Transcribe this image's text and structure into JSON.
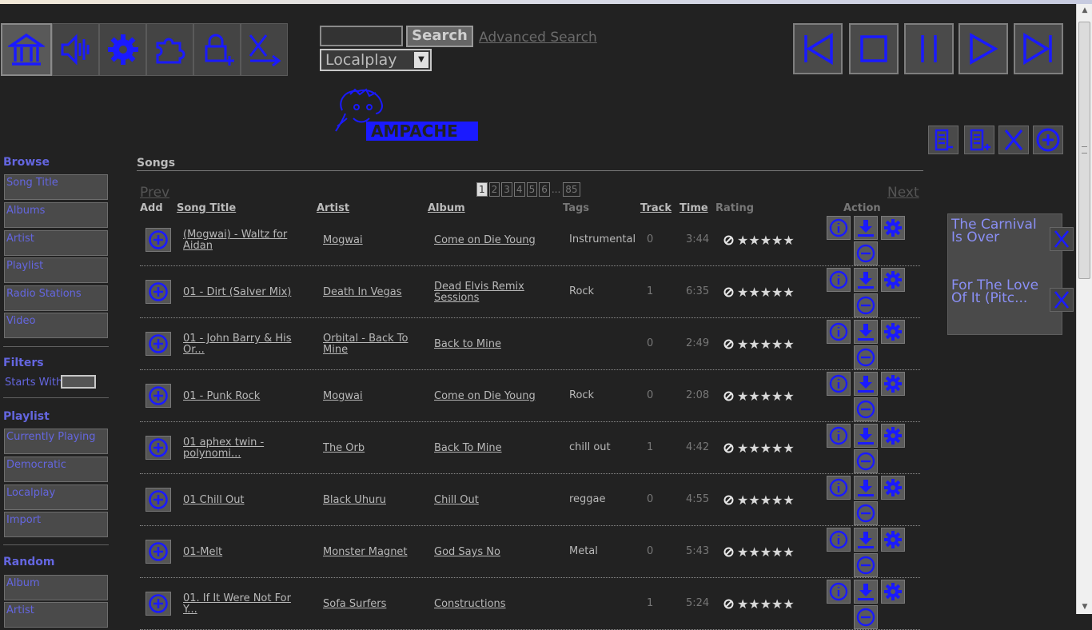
{
  "search": {
    "button_label": "Search",
    "advanced_label": "Advanced Search",
    "input_value": "",
    "player_select": "Localplay"
  },
  "nav_icons": [
    "home-icon",
    "speaker-icon",
    "gear-icon",
    "puzzle-icon",
    "lock-add-icon",
    "logout-icon"
  ],
  "sidebar": {
    "browse_heading": "Browse",
    "browse_items": [
      "Song Title",
      "Albums",
      "Artist",
      "Playlist",
      "Radio Stations",
      "Video"
    ],
    "filters_heading": "Filters",
    "starts_with_label": "Starts With",
    "playlist_heading": "Playlist",
    "playlist_items": [
      "Currently Playing",
      "Democratic",
      "Localplay",
      "Import"
    ],
    "random_heading": "Random",
    "random_items": [
      "Album",
      "Artist"
    ]
  },
  "songs": {
    "title": "Songs",
    "prev_label": "Prev",
    "next_label": "Next",
    "pages": [
      "1",
      "2",
      "3",
      "4",
      "5",
      "6"
    ],
    "pages_ellipsis": "...",
    "last_page": "85",
    "columns": {
      "add": "Add",
      "song_title": "Song Title",
      "artist": "Artist",
      "album": "Album",
      "tags": "Tags",
      "track": "Track",
      "time": "Time",
      "rating": "Rating",
      "action": "Action"
    },
    "rows": [
      {
        "title": "(Mogwai) - Waltz for Aidan",
        "artist": "Mogwai",
        "album": "Come on Die Young",
        "tags": "Instrumental",
        "track": "0",
        "time": "3:44"
      },
      {
        "title": "01 - Dirt (Salver Mix)",
        "artist": "Death In Vegas",
        "album": "Dead Elvis Remix Sessions",
        "tags": "Rock",
        "track": "1",
        "time": "6:35"
      },
      {
        "title": "01 - John Barry & His Or...",
        "artist": "Orbital - Back To Mine",
        "album": "Back to Mine",
        "tags": "",
        "track": "0",
        "time": "2:49"
      },
      {
        "title": "01 - Punk Rock",
        "artist": "Mogwai",
        "album": "Come on Die Young",
        "tags": "Rock",
        "track": "0",
        "time": "2:08"
      },
      {
        "title": "01 aphex twin - polynomi...",
        "artist": "The Orb",
        "album": "Back To Mine",
        "tags": "chill out",
        "track": "1",
        "time": "4:42"
      },
      {
        "title": "01 Chill Out",
        "artist": "Black Uhuru",
        "album": "Chill Out",
        "tags": "reggae",
        "track": "0",
        "time": "4:55"
      },
      {
        "title": "01-Melt",
        "artist": "Monster Magnet",
        "album": "God Says No",
        "tags": "Metal",
        "track": "0",
        "time": "5:43"
      },
      {
        "title": "01. If It Were Not For Y...",
        "artist": "Sofa Surfers",
        "album": "Constructions",
        "tags": "",
        "track": "1",
        "time": "5:24"
      }
    ],
    "rating_stars": "★★★★★"
  },
  "now_playing": [
    {
      "title": "The Carnival Is Over"
    },
    {
      "title": "For The Love Of It (Pitc..."
    }
  ],
  "colors": {
    "accent": "#1a1aff",
    "link_blue": "#6466e0",
    "background": "#222222"
  }
}
